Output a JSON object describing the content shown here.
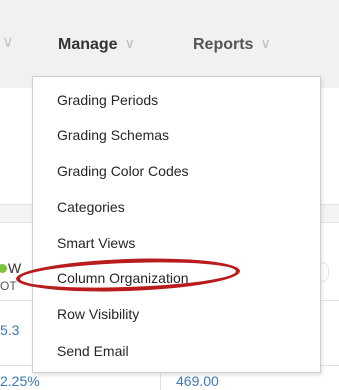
{
  "nav": {
    "left_partial_chevron": "∨",
    "tabs": [
      {
        "label": "Manage",
        "chevron": "∨"
      },
      {
        "label": "Reports",
        "chevron": "∨"
      }
    ]
  },
  "menu": {
    "items": [
      "Grading Periods",
      "Grading Schemas",
      "Grading Color Codes",
      "Categories",
      "Smart Views",
      "Column Organization",
      "Row Visibility",
      "Send Email"
    ]
  },
  "grid": {
    "partial_header_top": "W",
    "partial_header_bottom": "OT",
    "partial_value_1": "5.3",
    "bottom_left_value": "2.25%",
    "bottom_right_value": "469.00"
  },
  "colors": {
    "highlight": "#b81c1c",
    "link": "#3a7ab8",
    "status_dot": "#7cc242"
  }
}
